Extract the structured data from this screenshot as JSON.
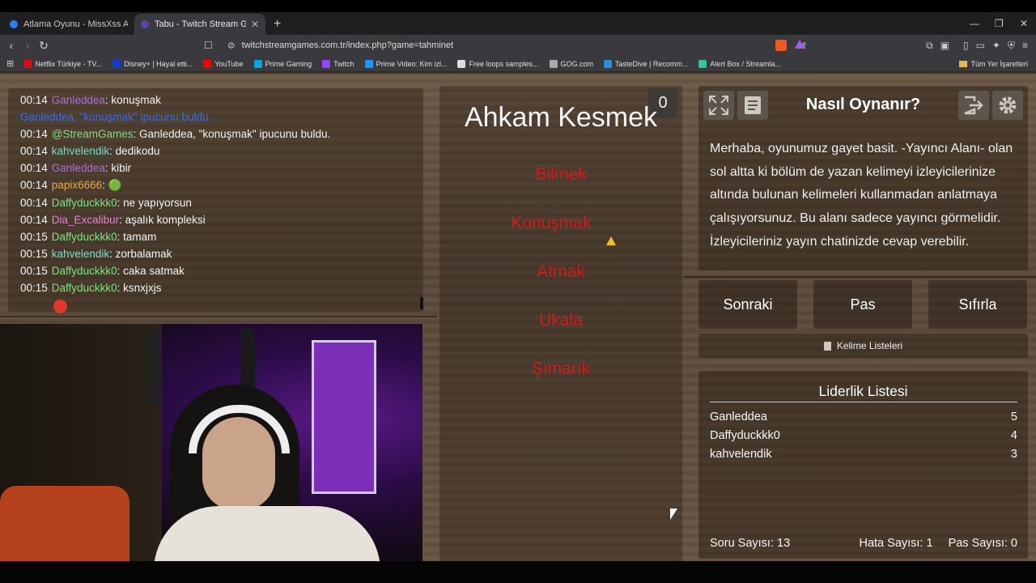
{
  "browser": {
    "tabs": [
      {
        "title": "Atlama Oyunu - MissXss AI Bot Syste",
        "active": false,
        "icon_color": "#2d7ff0"
      },
      {
        "title": "Tabu - Twitch Stream Games",
        "active": true,
        "icon_color": "#6441a5"
      }
    ],
    "new_tab_label": "+",
    "url": "twitchstreamgames.com.tr/index.php?game=tahminet",
    "bookmarks": [
      {
        "label": "Netflix Türkiye - TV...",
        "color": "#e50914"
      },
      {
        "label": "Disney+ | Hayal etti...",
        "color": "#113ccf"
      },
      {
        "label": "YouTube",
        "color": "#ff0000"
      },
      {
        "label": "Prime Gaming",
        "color": "#00a8e1"
      },
      {
        "label": "Twitch",
        "color": "#9146ff"
      },
      {
        "label": "Prime Video: Kim izl...",
        "color": "#1a98ff"
      },
      {
        "label": "Free loops samples...",
        "color": "#dddddd"
      },
      {
        "label": "GOG.com",
        "color": "#aaaaaa"
      },
      {
        "label": "TasteDive | Recomm...",
        "color": "#2a8fd8"
      },
      {
        "label": "Alert Box / Streamla...",
        "color": "#31c3a2"
      }
    ],
    "bookmarks_folder": "Tüm Yer İşaretleri"
  },
  "chat": {
    "messages": [
      {
        "time": "00:14",
        "user": "Ganleddea",
        "user_color": "#b469e8",
        "sep": ": ",
        "text": "konuşmak"
      },
      {
        "time": "",
        "user": "Ganleddea",
        "user_color": "#3b6ee8",
        "sep": ", ",
        "text": "\"konuşmak\" ipucunu buldu.",
        "special": true
      },
      {
        "time": "00:14",
        "user": "@StreamGames",
        "user_color": "#7ee07e",
        "sep": ": ",
        "text": "Ganleddea, \"konuşmak\" ipucunu buldu."
      },
      {
        "time": "00:14",
        "user": "kahvelendik",
        "user_color": "#6fe0c8",
        "sep": ": ",
        "text": "dedikodu"
      },
      {
        "time": "00:14",
        "user": "Ganleddea",
        "user_color": "#b469e8",
        "sep": ": ",
        "text": "kibir"
      },
      {
        "time": "00:14",
        "user": "papix6666",
        "user_color": "#e8a84a",
        "sep": ": ",
        "text": "🟢"
      },
      {
        "time": "00:14",
        "user": "Daffyduckkk0",
        "user_color": "#7ee07e",
        "sep": ": ",
        "text": "ne yapıyorsun"
      },
      {
        "time": "00:14",
        "user": "Dia_Excalibur",
        "user_color": "#f07ad8",
        "sep": ": ",
        "text": "aşalık kompleksi"
      },
      {
        "time": "00:15",
        "user": "Daffyduckkk0",
        "user_color": "#7ee07e",
        "sep": ": ",
        "text": "tamam"
      },
      {
        "time": "00:15",
        "user": "kahvelendik",
        "user_color": "#6fe0c8",
        "sep": ": ",
        "text": "zorbalamak"
      },
      {
        "time": "00:15",
        "user": "Daffyduckkk0",
        "user_color": "#7ee07e",
        "sep": ": ",
        "text": "caka satmak"
      },
      {
        "time": "00:15",
        "user": "Daffyduckkk0",
        "user_color": "#7ee07e",
        "sep": ": ",
        "text": "ksnxjxjs"
      }
    ]
  },
  "game": {
    "score": "0",
    "main_word": "Ahkam Kesmek",
    "forbidden_words": [
      "Bilmek",
      "Konuşmak",
      "Atmak",
      "Ukala",
      "Şımarık"
    ]
  },
  "howto": {
    "title": "Nasıl Oynanır?",
    "text": "Merhaba, oyunumuz gayet basit. -Yayıncı Alanı- olan sol altta ki bölüm de yazan kelimeyi izleyicilerinize altında bulunan kelimeleri kullanmadan anlatmaya çalışıyorsunuz. Bu alanı sadece yayıncı görmelidir. İzleyicileriniz yayın chatinizde cevap verebilir."
  },
  "controls": {
    "next": "Sonraki",
    "pass": "Pas",
    "reset": "Sıfırla",
    "word_lists": "Kelime Listeleri"
  },
  "leaderboard": {
    "title": "Liderlik Listesi",
    "rows": [
      {
        "name": "Ganleddea",
        "score": "5"
      },
      {
        "name": "Daffyduckkk0",
        "score": "4"
      },
      {
        "name": "kahvelendik",
        "score": "3"
      }
    ]
  },
  "stats": {
    "questions": "Soru Sayısı: 13",
    "errors": "Hata Sayısı: 1",
    "passes": "Pas Sayısı: 0"
  }
}
